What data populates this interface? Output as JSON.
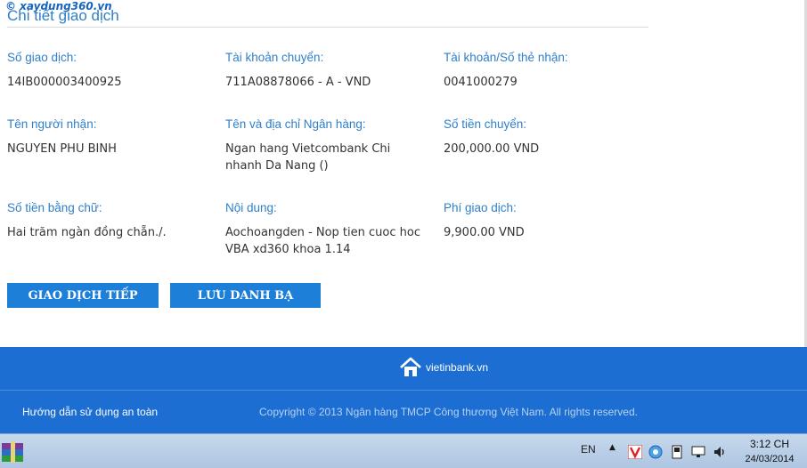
{
  "watermark": "© xaydung360.vn",
  "section_title": "Chi tiết giao dịch",
  "fields": {
    "transaction_no": {
      "label": "Số giao dịch:",
      "value": "14IB000003400925"
    },
    "from_account": {
      "label": "Tài khoản chuyển:",
      "value": "711A08878066 - A - VND"
    },
    "to_account": {
      "label": "Tài khoản/Số thẻ nhận:",
      "value": "0041000279"
    },
    "recipient": {
      "label": "Tên người nhận:",
      "value": "NGUYEN PHU BINH"
    },
    "bank": {
      "label": "Tên và địa chỉ Ngân hàng:",
      "value": "Ngan hang Vietcombank Chi nhanh Da Nang ()"
    },
    "amount": {
      "label": "Số tiền chuyển:",
      "value": "200,000.00 VND"
    },
    "amount_words": {
      "label": "Số tiền bằng chữ:",
      "value": "Hai trăm ngàn đồng chẵn./."
    },
    "content": {
      "label": "Nội dung:",
      "value": "Aochoangden - Nop tien cuoc hoc VBA xd360 khoa 1.14"
    },
    "fee": {
      "label": "Phí giao dịch:",
      "value": "9,900.00 VND"
    }
  },
  "buttons": {
    "continue": "GIAO DỊCH TIẾP",
    "save_contact": "LƯU DANH BẠ"
  },
  "footer": {
    "brand": "vietinbank.vn",
    "guide_link": "Hướng dẫn sử dụng an toàn",
    "copyright": "Copyright © 2013 Ngân hàng TMCP Công thương Việt Nam. All rights reserved."
  },
  "taskbar": {
    "language": "EN",
    "time": "3:12 CH",
    "date": "24/03/2014"
  },
  "colors": {
    "accent": "#2f7fc9",
    "button": "#1e7fd8",
    "footer": "#1c6ed2"
  }
}
